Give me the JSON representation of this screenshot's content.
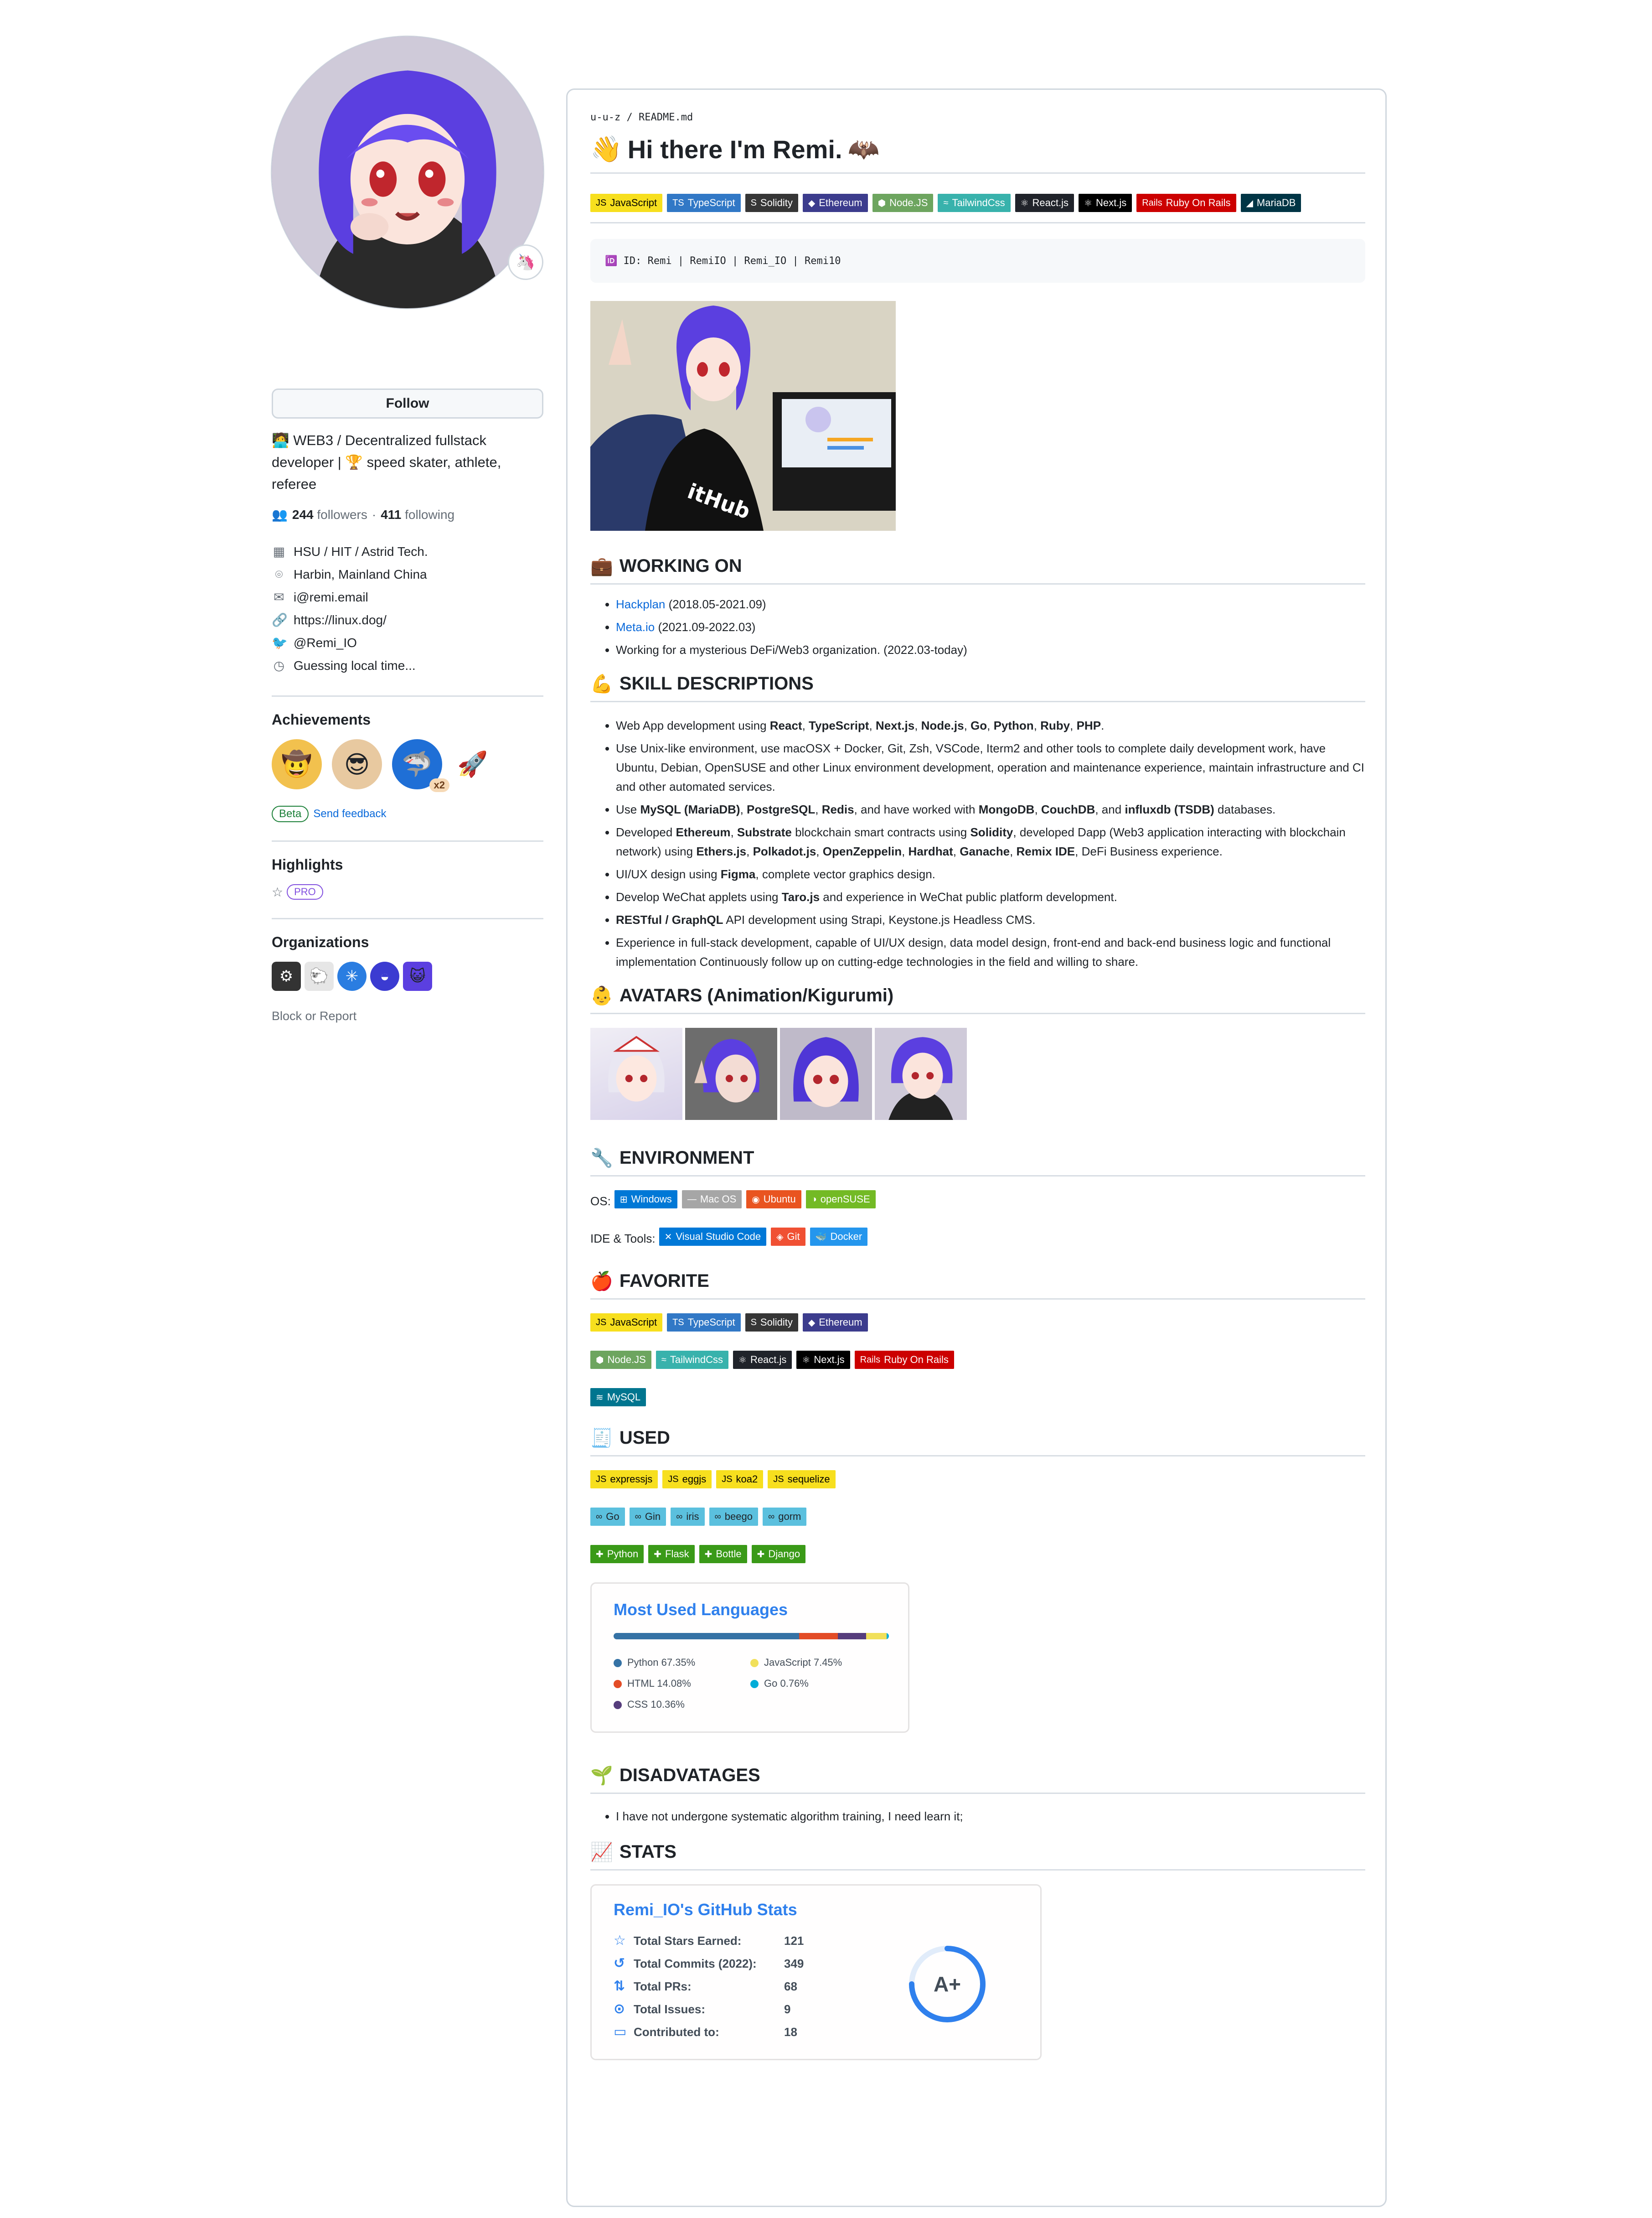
{
  "profile": {
    "follow_label": "Follow",
    "bio": "🧑‍💻 WEB3 / Decentralized fullstack developer | 🏆 speed skater, athlete, referee",
    "followers": "244",
    "followers_label": "followers",
    "sep": "·",
    "following": "411",
    "following_label": "following",
    "details": [
      {
        "icon": "building-icon",
        "glyph": "▦",
        "text": "HSU / HIT / Astrid Tech."
      },
      {
        "icon": "location-icon",
        "glyph": "⌾",
        "text": "Harbin, Mainland China"
      },
      {
        "icon": "mail-icon",
        "glyph": "✉",
        "text": "i@remi.email"
      },
      {
        "icon": "link-icon",
        "glyph": "🔗",
        "text": "https://linux.dog/"
      },
      {
        "icon": "twitter-icon",
        "glyph": "🐦",
        "text": "@Remi_IO"
      },
      {
        "icon": "clock-icon",
        "glyph": "◷",
        "text": "Guessing local time..."
      }
    ],
    "achievements_title": "Achievements",
    "achievements_multiplier": "x2",
    "beta_label": "Beta",
    "send_feedback": "Send feedback",
    "highlights_title": "Highlights",
    "pro_label": "PRO",
    "organizations_title": "Organizations",
    "block_report": "Block or Report"
  },
  "readme": {
    "path_user": "u-u-z",
    "path_sep": " / ",
    "path_file": "README.md",
    "title_emoji": "👋",
    "title": "Hi there I'm Remi.",
    "title_emoji2": "🦇",
    "top_badges": [
      {
        "label": "JavaScript",
        "icon": "JS",
        "bg": "#f7df1e",
        "fg": "#000000"
      },
      {
        "label": "TypeScript",
        "icon": "TS",
        "bg": "#3178c6",
        "fg": "#ffffff"
      },
      {
        "label": "Solidity",
        "icon": "S",
        "bg": "#363636",
        "fg": "#ffffff"
      },
      {
        "label": "Ethereum",
        "icon": "◆",
        "bg": "#3c3c8d",
        "fg": "#ffffff"
      },
      {
        "label": "Node.JS",
        "icon": "⬢",
        "bg": "#6da55f",
        "fg": "#ffffff"
      },
      {
        "label": "TailwindCss",
        "icon": "≈",
        "bg": "#38b2ac",
        "fg": "#ffffff"
      },
      {
        "label": "React.js",
        "icon": "⚛",
        "bg": "#20232a",
        "fg": "#ffffff"
      },
      {
        "label": "Next.js",
        "icon": "⚛",
        "bg": "#000000",
        "fg": "#ffffff"
      },
      {
        "label": "Ruby On Rails",
        "icon": "Rails",
        "bg": "#cc0000",
        "fg": "#ffffff"
      },
      {
        "label": "MariaDB",
        "icon": "◢",
        "bg": "#003545",
        "fg": "#ffffff"
      }
    ],
    "code_text": "🆔 ID: Remi | RemiIO | Remi_IO | Remi10",
    "working_on_emoji": "💼",
    "working_on_title": "WORKING ON",
    "working_on": [
      {
        "link": "Hackplan",
        "text": " (2018.05-2021.09)"
      },
      {
        "link": "Meta.io",
        "text": " (2021.09-2022.03)"
      },
      {
        "link": "",
        "text": "Working for a mysterious DeFi/Web3 organization. (2022.03-today)"
      }
    ],
    "skills_emoji": "💪",
    "skills_title": "SKILL DESCRIPTIONS",
    "skills": [
      "Web App development using <b>React</b>, <b>TypeScript</b>, <b>Next.js</b>, <b>Node.js</b>, <b>Go</b>, <b>Python</b>, <b>Ruby</b>, <b>PHP</b>.",
      "Use Unix-like environment, use macOSX + Docker, Git, Zsh, VSCode, Iterm2 and other tools to complete daily development work, have Ubuntu, Debian, OpenSUSE and other Linux environment development, operation and maintenance experience, maintain infrastructure and CI and other automated services.",
      "Use <b>MySQL (MariaDB)</b>, <b>PostgreSQL</b>, <b>Redis</b>, and have worked with <b>MongoDB</b>, <b>CouchDB</b>, and <b>influxdb (TSDB)</b> databases.",
      "Developed <b>Ethereum</b>, <b>Substrate</b> blockchain smart contracts using <b>Solidity</b>, developed Dapp (Web3 application interacting with blockchain network) using <b>Ethers.js</b>, <b>Polkadot.js</b>, <b>OpenZeppelin</b>, <b>Hardhat</b>, <b>Ganache</b>, <b>Remix IDE</b>, DeFi Business experience.",
      "UI/UX design using <b>Figma</b>, complete vector graphics design.",
      "Develop WeChat applets using <b>Taro.js</b> and experience in WeChat public platform development.",
      "<b>RESTful / GraphQL</b> API development using Strapi, Keystone.js Headless CMS.",
      "Experience in full-stack development, capable of UI/UX design, data model design, front-end and back-end business logic and functional implementation Continuously follow up on cutting-edge technologies in the field and willing to share."
    ],
    "avatars_emoji": "👶",
    "avatars_title": "AVATARS (Animation/Kigurumi)",
    "env_emoji": "🔧",
    "env_title": "ENVIRONMENT",
    "os_label": "OS:",
    "os_badges": [
      {
        "label": "Windows",
        "icon": "⊞",
        "bg": "#0078d6",
        "fg": "#ffffff"
      },
      {
        "label": "Mac OS",
        "icon": "—",
        "bg": "#a6a6a6",
        "fg": "#ffffff"
      },
      {
        "label": "Ubuntu",
        "icon": "◉",
        "bg": "#e95420",
        "fg": "#ffffff"
      },
      {
        "label": "openSUSE",
        "icon": "◑",
        "bg": "#73ba25",
        "fg": "#ffffff"
      }
    ],
    "ide_label": "IDE & Tools:",
    "ide_badges": [
      {
        "label": "Visual Studio Code",
        "icon": "✕",
        "bg": "#0078d7",
        "fg": "#ffffff"
      },
      {
        "label": "Git",
        "icon": "◈",
        "bg": "#f05033",
        "fg": "#ffffff"
      },
      {
        "label": "Docker",
        "icon": "🐳",
        "bg": "#2496ed",
        "fg": "#ffffff"
      }
    ],
    "fav_emoji": "🍎",
    "fav_title": "FAVORITE",
    "fav_rows": [
      [
        {
          "label": "JavaScript",
          "icon": "JS",
          "bg": "#f7df1e",
          "fg": "#000000"
        },
        {
          "label": "TypeScript",
          "icon": "TS",
          "bg": "#3178c6",
          "fg": "#ffffff"
        },
        {
          "label": "Solidity",
          "icon": "S",
          "bg": "#363636",
          "fg": "#ffffff"
        },
        {
          "label": "Ethereum",
          "icon": "◆",
          "bg": "#3c3c8d",
          "fg": "#ffffff"
        }
      ],
      [
        {
          "label": "Node.JS",
          "icon": "⬢",
          "bg": "#6da55f",
          "fg": "#ffffff"
        },
        {
          "label": "TailwindCss",
          "icon": "≈",
          "bg": "#38b2ac",
          "fg": "#ffffff"
        },
        {
          "label": "React.js",
          "icon": "⚛",
          "bg": "#20232a",
          "fg": "#ffffff"
        },
        {
          "label": "Next.js",
          "icon": "⚛",
          "bg": "#000000",
          "fg": "#ffffff"
        },
        {
          "label": "Ruby On Rails",
          "icon": "Rails",
          "bg": "#cc0000",
          "fg": "#ffffff"
        }
      ],
      [
        {
          "label": "MySQL",
          "icon": "≋",
          "bg": "#00758f",
          "fg": "#ffffff"
        }
      ]
    ],
    "used_emoji": "🧾",
    "used_title": "USED",
    "used_rows": [
      [
        {
          "label": "expressjs",
          "icon": "JS",
          "bg": "#f7df1e",
          "fg": "#000000"
        },
        {
          "label": "eggjs",
          "icon": "JS",
          "bg": "#f7df1e",
          "fg": "#000000"
        },
        {
          "label": "koa2",
          "icon": "JS",
          "bg": "#f7df1e",
          "fg": "#000000"
        },
        {
          "label": "sequelize",
          "icon": "JS",
          "bg": "#f7df1e",
          "fg": "#000000"
        }
      ],
      [
        {
          "label": "Go",
          "icon": "∞",
          "bg": "#5bc0de",
          "fg": "#1f2328"
        },
        {
          "label": "Gin",
          "icon": "∞",
          "bg": "#5bc0de",
          "fg": "#1f2328"
        },
        {
          "label": "iris",
          "icon": "∞",
          "bg": "#5bc0de",
          "fg": "#1f2328"
        },
        {
          "label": "beego",
          "icon": "∞",
          "bg": "#5bc0de",
          "fg": "#1f2328"
        },
        {
          "label": "gorm",
          "icon": "∞",
          "bg": "#5bc0de",
          "fg": "#1f2328"
        }
      ],
      [
        {
          "label": "Python",
          "icon": "✚",
          "bg": "#3a9a18",
          "fg": "#ffffff"
        },
        {
          "label": "Flask",
          "icon": "✚",
          "bg": "#3a9a18",
          "fg": "#ffffff"
        },
        {
          "label": "Bottle",
          "icon": "✚",
          "bg": "#3a9a18",
          "fg": "#ffffff"
        },
        {
          "label": "Django",
          "icon": "✚",
          "bg": "#3a9a18",
          "fg": "#ffffff"
        }
      ]
    ],
    "langs_title": "Most Used Languages",
    "langs": [
      {
        "name": "Python",
        "pct": 67.35,
        "label": "67.35%",
        "color": "#3572a5"
      },
      {
        "name": "HTML",
        "pct": 14.08,
        "label": "14.08%",
        "color": "#e34c26"
      },
      {
        "name": "CSS",
        "pct": 10.36,
        "label": "10.36%",
        "color": "#563d7c"
      },
      {
        "name": "JavaScript",
        "pct": 7.45,
        "label": "7.45%",
        "color": "#f1e05a"
      },
      {
        "name": "Go",
        "pct": 0.76,
        "label": "0.76%",
        "color": "#00add8"
      }
    ],
    "dis_emoji": "🌱",
    "dis_title": "DISADVATAGES",
    "disadvantages": [
      "I have not undergone systematic algorithm training, I need learn it;"
    ],
    "stats_emoji": "📈",
    "stats_title": "STATS",
    "stats_card_title": "Remi_IO's GitHub Stats",
    "stats": [
      {
        "icon": "star-icon",
        "glyph": "☆",
        "label": "Total Stars Earned:",
        "value": "121"
      },
      {
        "icon": "history-icon",
        "glyph": "↺",
        "label": "Total Commits (2022):",
        "value": "349"
      },
      {
        "icon": "pr-icon",
        "glyph": "⇅",
        "label": "Total PRs:",
        "value": "68"
      },
      {
        "icon": "issue-icon",
        "glyph": "⊙",
        "label": "Total Issues:",
        "value": "9"
      },
      {
        "icon": "repo-icon",
        "glyph": "▭",
        "label": "Contributed to:",
        "value": "18"
      }
    ],
    "rank": "A+",
    "rank_progress": 0.75
  }
}
